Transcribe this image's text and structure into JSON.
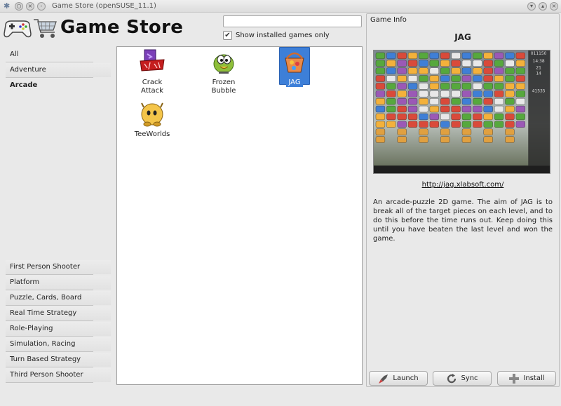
{
  "window": {
    "title": "Game Store (openSUSE_11.1)",
    "controls_left": [
      "app-menu",
      "sticky",
      "close",
      "minimize"
    ],
    "controls_right": [
      "minimize",
      "maximize",
      "close"
    ]
  },
  "header": {
    "app_title": "Game Store",
    "search": {
      "value": "",
      "placeholder": ""
    },
    "installed_only": {
      "label": "Show installed games only",
      "checked": true
    }
  },
  "categories": [
    {
      "label": "All"
    },
    {
      "label": "Adventure"
    },
    {
      "label": "Arcade",
      "active": true
    },
    {
      "label": "First Person Shooter"
    },
    {
      "label": "Platform"
    },
    {
      "label": "Puzzle, Cards, Board"
    },
    {
      "label": "Real Time Strategy"
    },
    {
      "label": "Role-Playing"
    },
    {
      "label": "Simulation, Racing"
    },
    {
      "label": "Turn Based Strategy"
    },
    {
      "label": "Third Person Shooter"
    }
  ],
  "games": [
    {
      "label": "Crack\nAttack",
      "icon": "crack-attack-icon"
    },
    {
      "label": "Frozen\nBubble",
      "icon": "frozen-bubble-icon"
    },
    {
      "label": "JAG",
      "icon": "jag-icon",
      "selected": true
    },
    {
      "label": "TeeWorlds",
      "icon": "teeworlds-icon"
    }
  ],
  "info": {
    "caption": "Game Info",
    "name": "JAG",
    "link": "http://jag.xlabsoft.com/",
    "description": "An arcade-puzzle 2D game. The aim of JAG is to break all of the target pieces on each level, and to do this before the time runs out. Keep doing this until you have beaten the last level and won the game.",
    "screenshot_hud": [
      "011150",
      "14:38",
      "21",
      "14",
      "41535"
    ],
    "buttons": {
      "launch": "Launch",
      "sync": "Sync",
      "install": "Install"
    }
  },
  "colors": {
    "selection": "#3d7fd8",
    "window_bg": "#e9e9e9",
    "panel_bg": "#ffffff"
  }
}
